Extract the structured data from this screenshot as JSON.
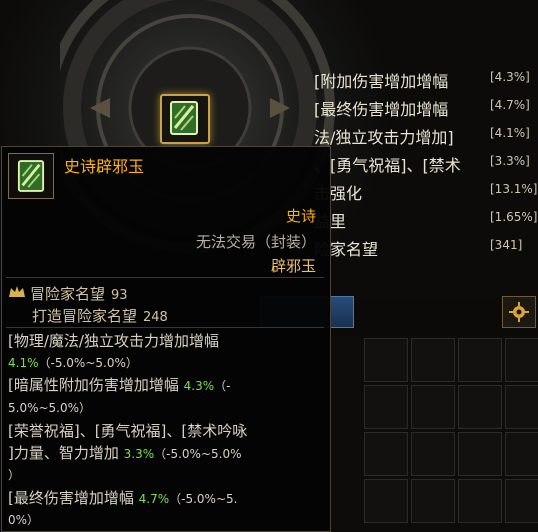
{
  "stats": [
    {
      "name": "[附加伤害增加增幅",
      "value": "[4.3%]"
    },
    {
      "name": "[最终伤害增加增幅",
      "value": "[4.7%]"
    },
    {
      "name": "法/独立攻击力增加]",
      "value": "[4.1%]"
    },
    {
      "name": "、[勇气祝福]、[禁术",
      "value": "[3.3%]"
    },
    {
      "name": "击强化",
      "value": "[13.1%]"
    },
    {
      "name": "益里",
      "value": "[1.65%]"
    },
    {
      "name": "险家名望",
      "value": "[341]"
    }
  ],
  "tooltip": {
    "title": "史诗辟邪玉",
    "rarity": "史诗",
    "trade": "无法交易（封装）",
    "item_type": "辟邪玉",
    "fame_label": "冒险家名望",
    "fame_value": "93",
    "forge_label": "打造冒险家名望",
    "forge_value": "248",
    "options": [
      {
        "line1": "[物理/魔法/独立攻击力增加增幅",
        "pct": "4.1%",
        "range": "（-5.0%~5.0%）",
        "line2": ""
      },
      {
        "line1": "[暗属性附加伤害增加增幅",
        "pct": "4.3%",
        "range": "（-",
        "line2": "5.0%~5.0%）"
      },
      {
        "line1": "[荣誉祝福]、[勇气祝福]、[禁术吟咏",
        "line2_pre": "]力量、智力增加",
        "pct": "3.3%",
        "range": "（-5.0%~5.0%",
        "line3": "）"
      },
      {
        "line1": "[最终伤害增加增幅",
        "pct": "4.7%",
        "range": "（-5.0%~5.",
        "line2": "0%）"
      }
    ]
  },
  "colors": {
    "epic": "#ffb400",
    "percent": "#7be04e",
    "gold_border": "#c9a24a"
  },
  "icons": [
    "jade-card-icon",
    "fame-crown-icon",
    "gear-icon"
  ]
}
